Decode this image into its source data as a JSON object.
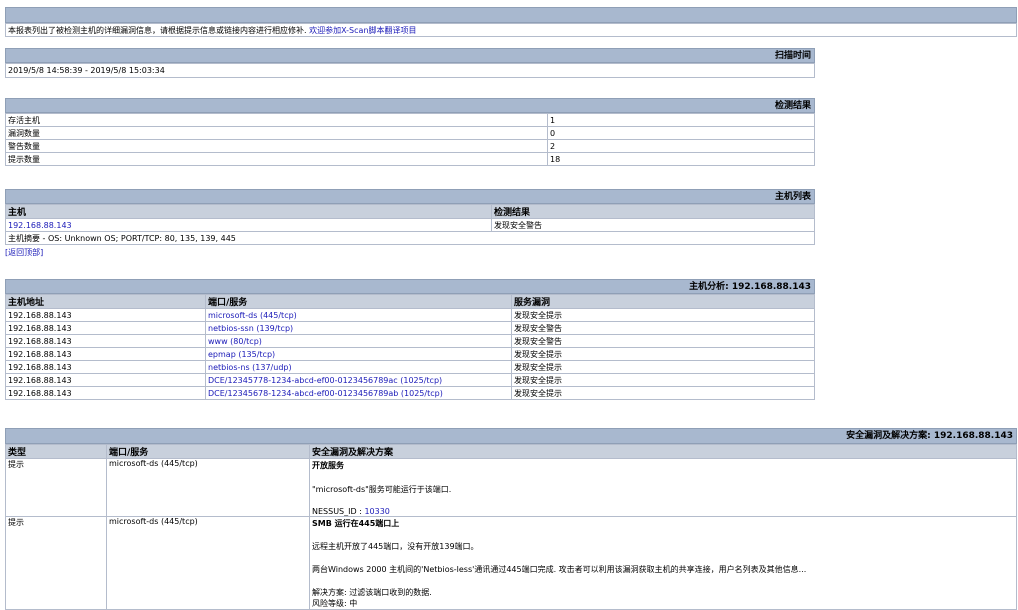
{
  "intro": {
    "text": "本报表列出了被检测主机的详细漏洞信息，请根据提示信息或链接内容进行相应修补. ",
    "link": "欢迎参加X-Scan脚本翻译项目"
  },
  "scan_time": {
    "header": "扫描时间",
    "value": "2019/5/8 14:58:39 - 2019/5/8 15:03:34"
  },
  "results": {
    "header": "检测结果",
    "rows": [
      {
        "label": "存活主机",
        "value": "1"
      },
      {
        "label": "漏洞数量",
        "value": "0"
      },
      {
        "label": "警告数量",
        "value": "2"
      },
      {
        "label": "提示数量",
        "value": "18"
      }
    ]
  },
  "host_list": {
    "header": "主机列表",
    "col_host": "主机",
    "col_result": "检测结果",
    "host": "192.168.88.143",
    "result": "发现安全警告",
    "summary": "主机摘要 - OS: Unknown OS; PORT/TCP: 80, 135, 139, 445",
    "back_link": "[返回顶部]"
  },
  "analysis": {
    "header": "主机分析: 192.168.88.143",
    "col_addr": "主机地址",
    "col_port": "端口/服务",
    "col_vuln": "服务漏洞",
    "rows": [
      {
        "addr": "192.168.88.143",
        "port": "microsoft-ds (445/tcp)",
        "vuln": "发现安全提示"
      },
      {
        "addr": "192.168.88.143",
        "port": "netbios-ssn (139/tcp)",
        "vuln": "发现安全警告"
      },
      {
        "addr": "192.168.88.143",
        "port": "www (80/tcp)",
        "vuln": "发现安全警告"
      },
      {
        "addr": "192.168.88.143",
        "port": "epmap (135/tcp)",
        "vuln": "发现安全提示"
      },
      {
        "addr": "192.168.88.143",
        "port": "netbios-ns (137/udp)",
        "vuln": "发现安全提示"
      },
      {
        "addr": "192.168.88.143",
        "port": "DCE/12345778-1234-abcd-ef00-0123456789ac (1025/tcp)",
        "vuln": "发现安全提示"
      },
      {
        "addr": "192.168.88.143",
        "port": "DCE/12345678-1234-abcd-ef00-0123456789ab (1025/tcp)",
        "vuln": "发现安全提示"
      }
    ]
  },
  "vulns": {
    "header": "安全漏洞及解决方案: 192.168.88.143",
    "col_type": "类型",
    "col_port": "端口/服务",
    "col_detail": "安全漏洞及解决方案",
    "items": [
      {
        "type": "提示",
        "port": "microsoft-ds (445/tcp)",
        "title": "开放服务",
        "desc": "\"microsoft-ds\"服务可能运行于该端口.",
        "nessus_label": "NESSUS_ID : ",
        "nessus_id": "10330"
      },
      {
        "type": "提示",
        "port": "microsoft-ds (445/tcp)",
        "title": "SMB 运行在445端口上",
        "line1": "远程主机开放了445端口，没有开放139端口。",
        "line2": "两台Windows 2000 主机间的'Netbios-less'通讯通过445端口完成. 攻击者可以利用该漏洞获取主机的共享连接，用户名列表及其他信息...",
        "solution": "解决方案: 过滤该端口收到的数据.",
        "risk": "风险等级: 中"
      }
    ]
  }
}
